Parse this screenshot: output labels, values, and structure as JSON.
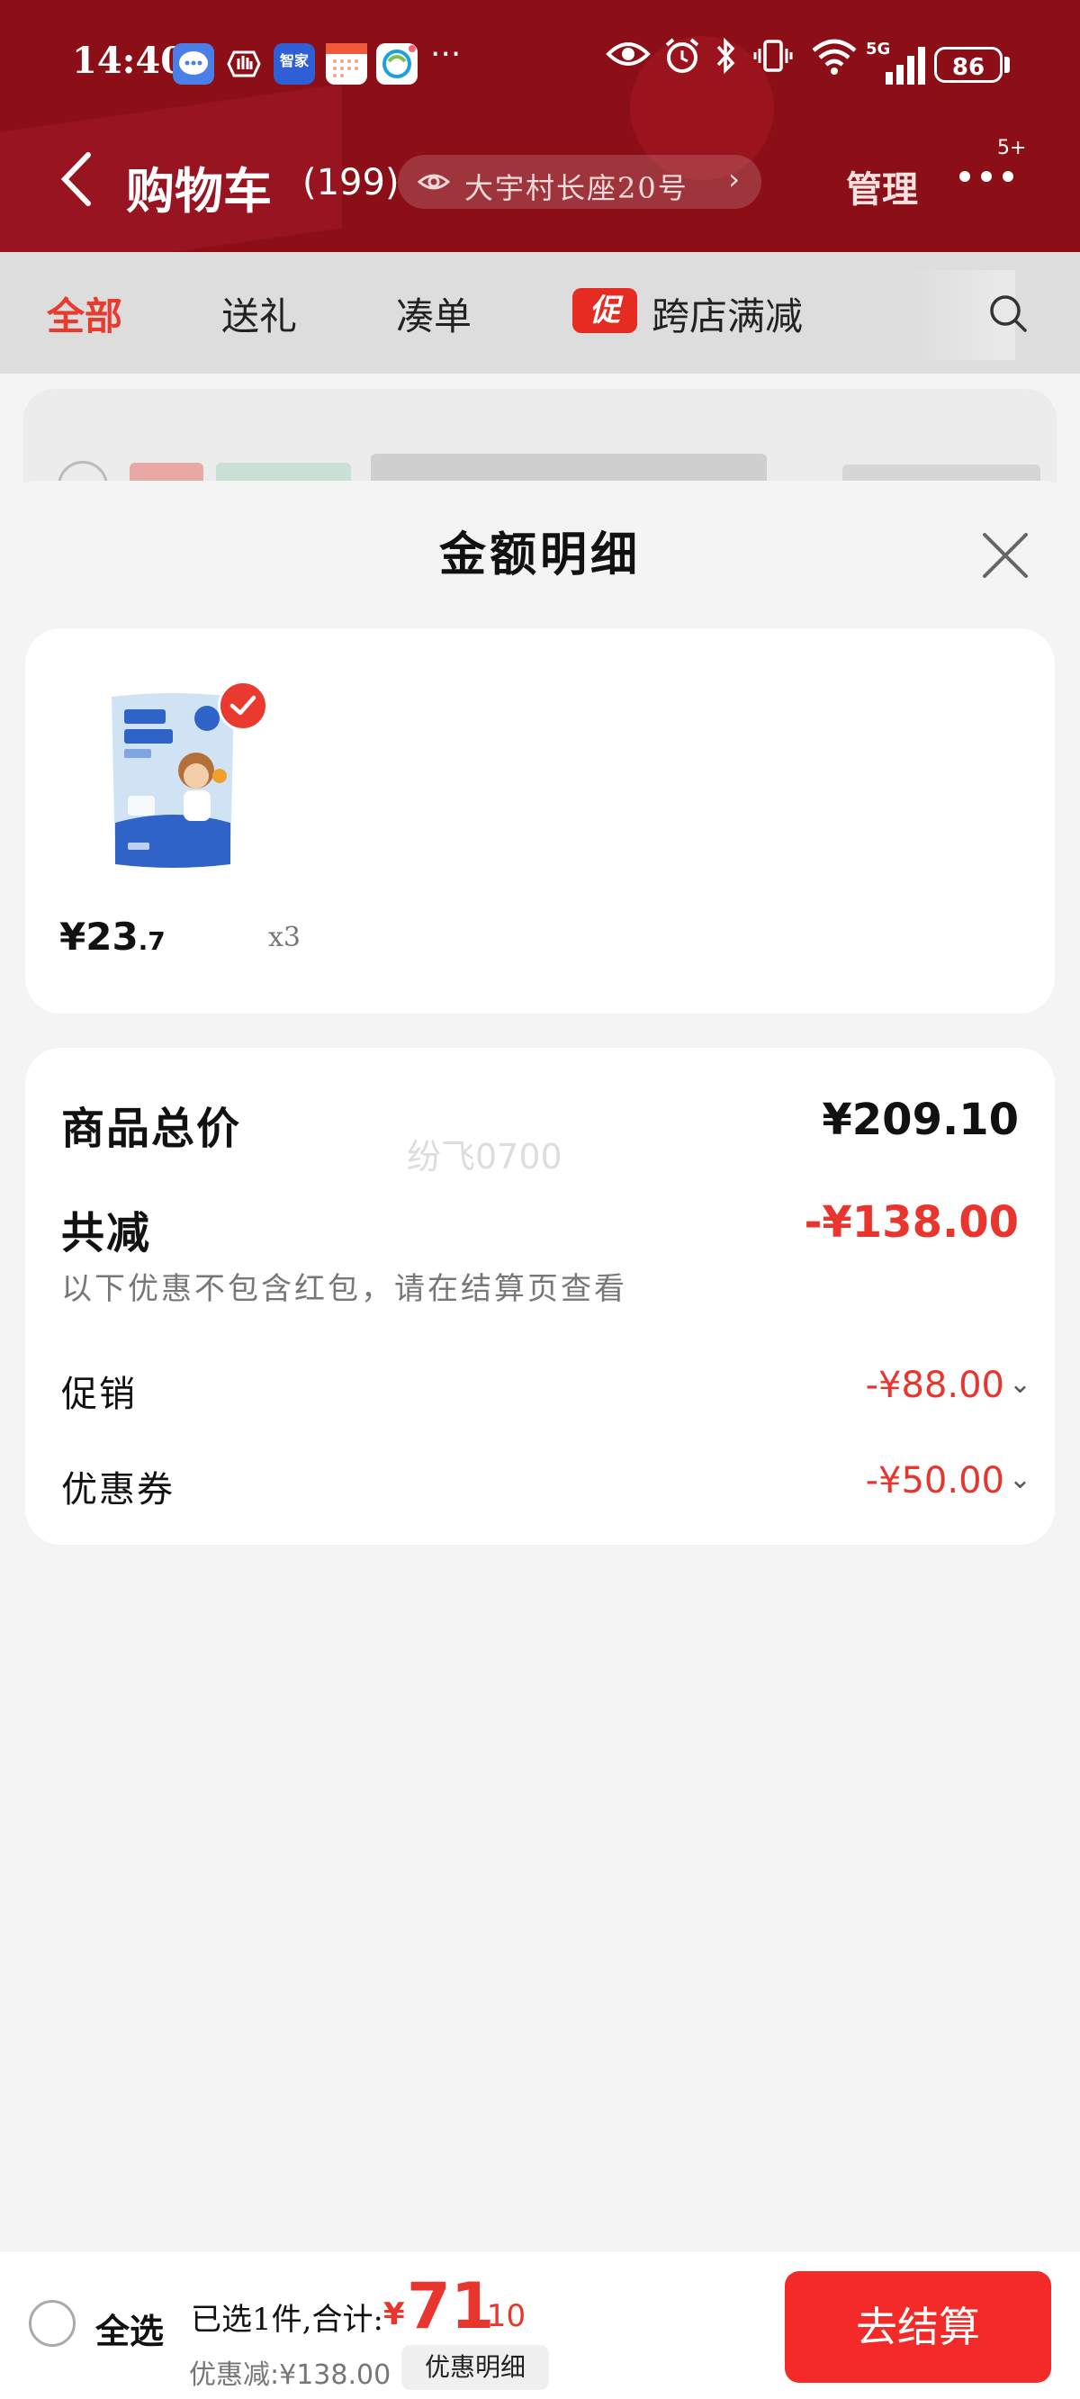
{
  "status_bar": {
    "time": "14:40",
    "app_icons": [
      "message-app-icon",
      "gesture-app-icon",
      "haier-app-icon",
      "calendar-app-icon",
      "mobile-app-icon"
    ],
    "haier_label": "智家",
    "more": "···",
    "battery": "86",
    "network": "5G"
  },
  "header": {
    "title": "购物车",
    "count": "(199)",
    "address": "大宇村长座20号",
    "manage": "管理",
    "badge": "5+"
  },
  "tabs": [
    "全部",
    "送礼",
    "凑单",
    "跨店满减"
  ],
  "promo_badge": "促",
  "sheet": {
    "title": "金额明细",
    "product": {
      "price_int": "¥23",
      "price_dec": ".7",
      "qty": "x3"
    },
    "summary": {
      "total_label": "商品总价",
      "total_value": "¥209.10",
      "discount_label": "共减",
      "discount_value": "-¥138.00",
      "note": "以下优惠不包含红包，请在结算页查看",
      "promo_label": "促销",
      "promo_value": "-¥88.00",
      "coupon_label": "优惠券",
      "coupon_value": "-¥50.00"
    },
    "watermark": "纷飞0700"
  },
  "bottom_bar": {
    "select_all": "全选",
    "selected_text": "已选1件,合计:",
    "total_yen": "¥",
    "total_int": "71",
    "total_dec": ".10",
    "discount_text": "优惠减:¥138.00",
    "detail_btn": "优惠明细",
    "checkout": "去结算"
  },
  "colors": {
    "header_bg": "#8c0f18",
    "accent_red": "#e8352d",
    "checkout_bg": "#f32a28"
  }
}
